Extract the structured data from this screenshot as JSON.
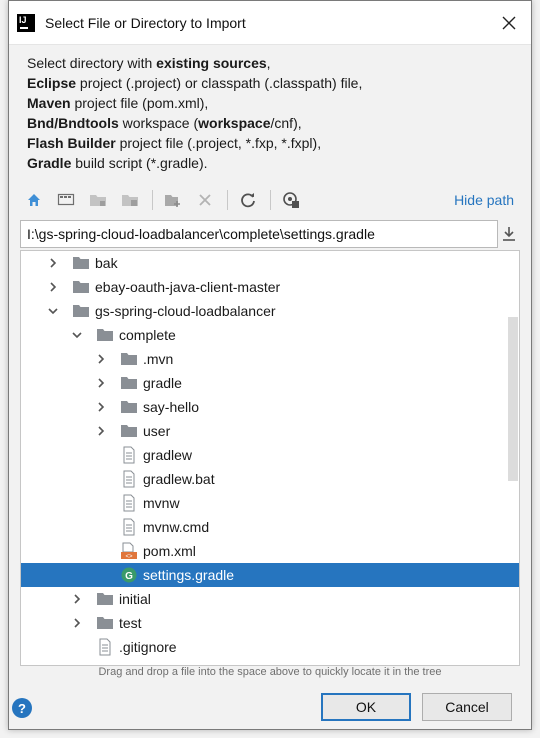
{
  "window": {
    "title": "Select File or Directory to Import",
    "app_icon_text": "IJ"
  },
  "description": {
    "lines": [
      {
        "bold": "",
        "text": "Select directory with ",
        "bold2": "existing sources",
        "tail": ","
      },
      {
        "bold": "Eclipse",
        "text": " project (.project) or classpath (.classpath) file,",
        "bold2": "",
        "tail": ""
      },
      {
        "bold": "Maven",
        "text": " project file (pom.xml),",
        "bold2": "",
        "tail": ""
      },
      {
        "bold": "Bnd/Bndtools",
        "text": " workspace (",
        "bold2": "workspace",
        "tail": "/cnf),"
      },
      {
        "bold": "Flash Builder",
        "text": " project file (.project, *.fxp, *.fxpl),",
        "bold2": "",
        "tail": ""
      },
      {
        "bold": "Gradle",
        "text": " build script (*.gradle).",
        "bold2": "",
        "tail": ""
      }
    ]
  },
  "toolbar": {
    "hide_path_label": "Hide path",
    "icons": [
      "home-icon",
      "desktop-icon",
      "project-folder-icon",
      "module-folder-icon",
      "new-folder-icon",
      "delete-icon",
      "refresh-icon",
      "show-hidden-icon"
    ]
  },
  "path": {
    "value": "I:\\gs-spring-cloud-loadbalancer\\complete\\settings.gradle"
  },
  "tree": {
    "rows": [
      {
        "label": "bak",
        "type": "folder",
        "indent": 0,
        "arrow": "collapsed"
      },
      {
        "label": "ebay-oauth-java-client-master",
        "type": "folder",
        "indent": 0,
        "arrow": "collapsed"
      },
      {
        "label": "gs-spring-cloud-loadbalancer",
        "type": "folder",
        "indent": 0,
        "arrow": "expanded"
      },
      {
        "label": "complete",
        "type": "folder",
        "indent": 1,
        "arrow": "expanded"
      },
      {
        "label": ".mvn",
        "type": "folder",
        "indent": 2,
        "arrow": "collapsed"
      },
      {
        "label": "gradle",
        "type": "folder",
        "indent": 2,
        "arrow": "collapsed"
      },
      {
        "label": "say-hello",
        "type": "folder",
        "indent": 2,
        "arrow": "collapsed"
      },
      {
        "label": "user",
        "type": "folder",
        "indent": 2,
        "arrow": "collapsed"
      },
      {
        "label": "gradlew",
        "type": "file",
        "indent": 2,
        "arrow": "none"
      },
      {
        "label": "gradlew.bat",
        "type": "file",
        "indent": 2,
        "arrow": "none"
      },
      {
        "label": "mvnw",
        "type": "file",
        "indent": 2,
        "arrow": "none"
      },
      {
        "label": "mvnw.cmd",
        "type": "file",
        "indent": 2,
        "arrow": "none"
      },
      {
        "label": "pom.xml",
        "type": "xml",
        "indent": 2,
        "arrow": "none"
      },
      {
        "label": "settings.gradle",
        "type": "gradle",
        "indent": 2,
        "arrow": "none",
        "selected": true
      },
      {
        "label": "initial",
        "type": "folder",
        "indent": 1,
        "arrow": "collapsed"
      },
      {
        "label": "test",
        "type": "folder",
        "indent": 1,
        "arrow": "collapsed"
      },
      {
        "label": ".gitignore",
        "type": "file",
        "indent": 1,
        "arrow": "none"
      }
    ]
  },
  "footer": {
    "hint": "Drag and drop a file into the space above to quickly locate it in the tree",
    "ok_label": "OK",
    "cancel_label": "Cancel",
    "help_label": "?"
  },
  "colors": {
    "accent": "#2675bf",
    "selection": "#2675bf",
    "folder": "#8a8f95"
  }
}
